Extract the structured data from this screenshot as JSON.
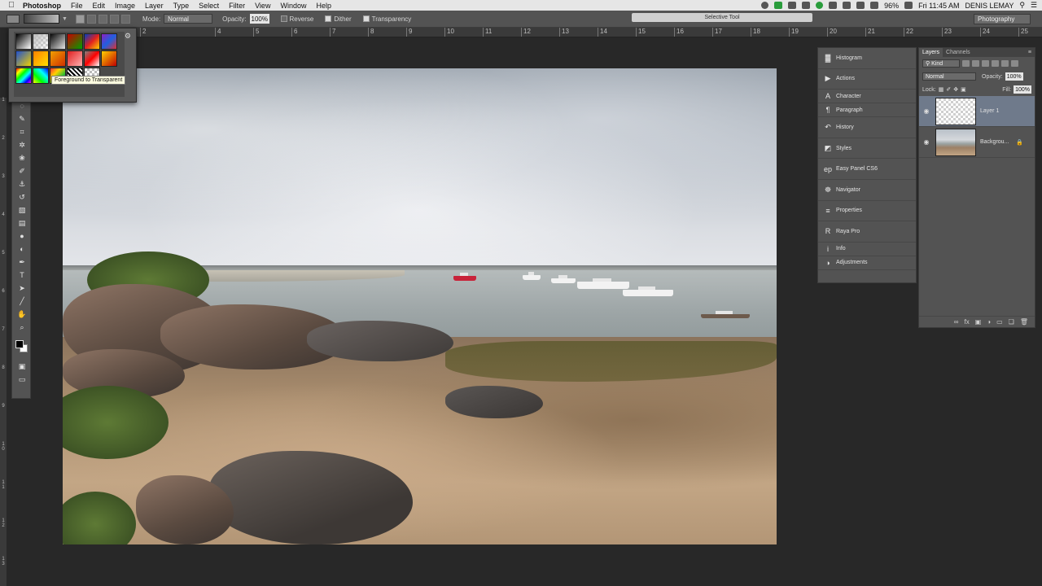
{
  "menubar": {
    "apple_icon": "apple-icon",
    "app_name": "Photoshop",
    "menus": [
      "File",
      "Edit",
      "Image",
      "Layer",
      "Type",
      "Select",
      "Filter",
      "View",
      "Window",
      "Help"
    ],
    "battery": "96%",
    "clock": "Fri 11:45 AM",
    "user": "DENIS LEMAY"
  },
  "options_bar": {
    "mode_label": "Mode:",
    "mode_value": "Normal",
    "opacity_label": "Opacity:",
    "opacity_value": "100%",
    "reverse_label": "Reverse",
    "dither_label": "Dither",
    "transparency_label": "Transparency",
    "reverse_checked": false,
    "dither_checked": true,
    "transparency_checked": true,
    "workspace": "Photography"
  },
  "floating_tab": {
    "title": "Selective Tool"
  },
  "ruler": {
    "top_ticks": [
      "2",
      "4",
      "5",
      "6",
      "7",
      "8",
      "9",
      "10",
      "11",
      "12",
      "13",
      "14",
      "15",
      "16",
      "17",
      "18",
      "19"
    ],
    "right_ticks": [
      "20",
      "21",
      "22",
      "23",
      "24",
      "25"
    ],
    "left_ticks": [
      "1",
      "2",
      "3",
      "4",
      "5",
      "6",
      "7",
      "8",
      "9",
      "1 0",
      "1 1",
      "1 2",
      "1 3"
    ]
  },
  "gradient_picker": {
    "tooltip": "Foreground to Transparent",
    "settings_icon": "gear-icon"
  },
  "toolbar": {
    "tools": [
      {
        "name": "lasso-tool-icon",
        "glyph": "◌"
      },
      {
        "name": "quick-select-tool-icon",
        "glyph": "✎"
      },
      {
        "name": "crop-tool-icon",
        "glyph": "⌗"
      },
      {
        "name": "eyedropper-tool-icon",
        "glyph": "✲"
      },
      {
        "name": "healing-brush-tool-icon",
        "glyph": "❀"
      },
      {
        "name": "brush-tool-icon",
        "glyph": "✐"
      },
      {
        "name": "clone-stamp-tool-icon",
        "glyph": "⚓"
      },
      {
        "name": "history-brush-tool-icon",
        "glyph": "↺"
      },
      {
        "name": "eraser-tool-icon",
        "glyph": "▧"
      },
      {
        "name": "gradient-tool-icon",
        "glyph": "▤"
      },
      {
        "name": "blur-tool-icon",
        "glyph": "●"
      },
      {
        "name": "dodge-tool-icon",
        "glyph": "◐"
      },
      {
        "name": "pen-tool-icon",
        "glyph": "✒"
      },
      {
        "name": "type-tool-icon",
        "glyph": "T"
      },
      {
        "name": "path-selection-tool-icon",
        "glyph": "➤"
      },
      {
        "name": "line-tool-icon",
        "glyph": "╱"
      },
      {
        "name": "hand-tool-icon",
        "glyph": "✋"
      },
      {
        "name": "zoom-tool-icon",
        "glyph": "⌕"
      }
    ],
    "foreground_color": "#000000",
    "background_color": "#ffffff"
  },
  "right_panels": {
    "items": [
      {
        "icon": "histogram-icon",
        "glyph": "▓",
        "label": "Histogram"
      },
      {
        "icon": "actions-icon",
        "glyph": "▶",
        "label": "Actions"
      },
      {
        "icon": "character-icon",
        "glyph": "A",
        "label": "Character"
      },
      {
        "icon": "paragraph-icon",
        "glyph": "¶",
        "label": "Paragraph"
      },
      {
        "icon": "history-icon",
        "glyph": "↶",
        "label": "History"
      },
      {
        "icon": "styles-icon",
        "glyph": "◩",
        "label": "Styles"
      },
      {
        "icon": "easy-panel-icon",
        "glyph": "ep",
        "label": "Easy Panel CS6"
      },
      {
        "icon": "navigator-icon",
        "glyph": "☸",
        "label": "Navigator"
      },
      {
        "icon": "properties-icon",
        "glyph": "≡",
        "label": "Properties"
      },
      {
        "icon": "raya-pro-icon",
        "glyph": "R",
        "label": "Raya Pro"
      },
      {
        "icon": "info-icon",
        "glyph": "i",
        "label": "Info"
      },
      {
        "icon": "adjustments-icon",
        "glyph": "◑",
        "label": "Adjustments"
      }
    ]
  },
  "layers_panel": {
    "tabs": [
      "Layers",
      "Channels"
    ],
    "filter_label": "Kind",
    "blend_mode": "Normal",
    "opacity_label": "Opacity:",
    "opacity_value": "100%",
    "lock_label": "Lock:",
    "fill_label": "Fill:",
    "fill_value": "100%",
    "layers": [
      {
        "name": "Layer 1",
        "selected": true,
        "locked": false
      },
      {
        "name": "Backgrou...",
        "selected": false,
        "locked": true
      }
    ]
  }
}
